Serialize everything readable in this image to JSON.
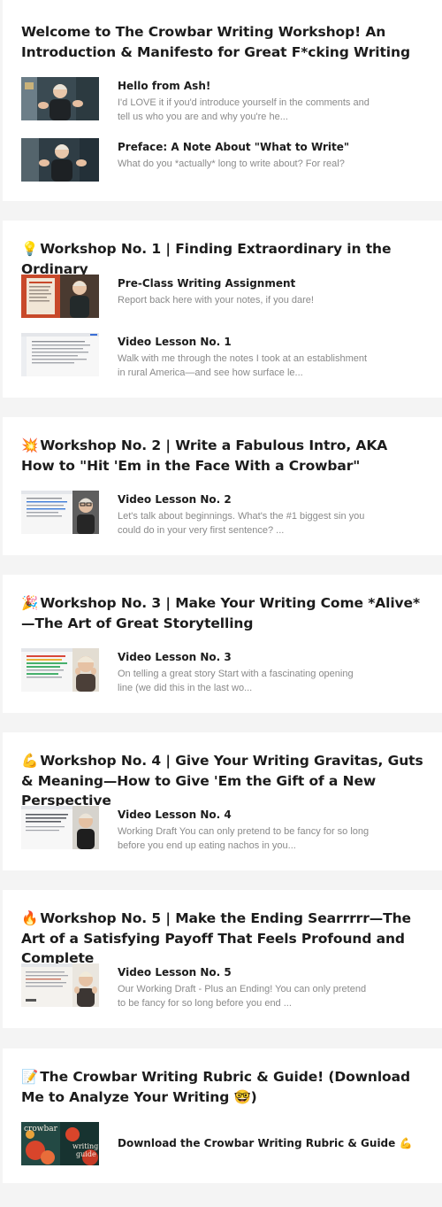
{
  "sections": [
    {
      "title": "Welcome to The Crowbar Writing Workshop! An Introduction & Manifesto for Great F*cking Writing",
      "emoji": "",
      "lessons": [
        {
          "title": "Hello from Ash!",
          "desc": "I'd LOVE it if you'd introduce yourself in the comments and tell us who you are and why you're he..."
        },
        {
          "title": "Preface: A Note About \"What to Write\"",
          "desc": "What do you *actually* long to write about? For real?"
        }
      ]
    },
    {
      "title": "Workshop No. 1 | Finding Extraordinary in the Ordinary",
      "emoji": "💡",
      "lessons": [
        {
          "title": "Pre-Class Writing Assignment",
          "desc": "Report back here with your notes, if you dare!"
        },
        {
          "title": "Video Lesson No. 1",
          "desc": "Walk with me through the notes I took at an establishment in rural America—and see how surface le..."
        }
      ]
    },
    {
      "title": "Workshop No. 2 | Write a Fabulous Intro, AKA How to \"Hit 'Em in the Face With a Crowbar\"",
      "emoji": "💥",
      "lessons": [
        {
          "title": "Video Lesson No. 2",
          "desc": "Let's talk about beginnings. What's the #1 biggest sin you could do in your very first sentence? ..."
        }
      ]
    },
    {
      "title": "Workshop No. 3 | Make Your Writing Come *Alive*—The Art of Great Storytelling",
      "emoji": "🎉",
      "lessons": [
        {
          "title": "Video Lesson No. 3",
          "desc": "On telling a great story   Start with a fascinating opening line (we did this in the last wo..."
        }
      ]
    },
    {
      "title": "Workshop No. 4 | Give Your Writing Gravitas, Guts & Meaning—How to Give 'Em the Gift of a New Perspective",
      "emoji": "💪",
      "lessons": [
        {
          "title": "Video Lesson No. 4",
          "desc": "Working Draft You can only pretend to be fancy for so long before you end up eating nachos in you..."
        }
      ]
    },
    {
      "title": "Workshop No. 5 | Make the Ending Searrrrr—The Art of a Satisfying Payoff That Feels Profound and Complete",
      "emoji": "🔥",
      "lessons": [
        {
          "title": "Video Lesson No. 5",
          "desc": " Our Working Draft - Plus an Ending! You can only pretend to be fancy for so long before you end ..."
        }
      ]
    },
    {
      "title": "The Crowbar Writing Rubric & Guide! (Download Me to Analyze Your Writing 🤓)",
      "emoji": "📝",
      "lessons": [
        {
          "title": "Download the Crowbar Writing Rubric & Guide 💪",
          "desc": ""
        }
      ]
    }
  ],
  "thumb_text": {
    "rubric_line1": "crowbar",
    "rubric_line2": "writing",
    "rubric_line3": "guide"
  }
}
